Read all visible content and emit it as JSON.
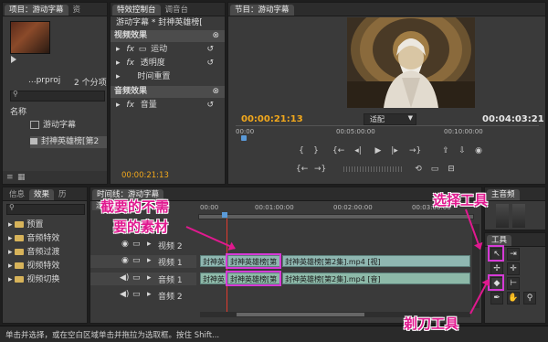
{
  "project": {
    "tab_project": "项目：游动字幕",
    "tab_resource": "资",
    "file_name": "...prproj",
    "item_count": "2 个分项",
    "search_placeholder": "",
    "col_name": "名称",
    "items": [
      {
        "label": "游动字幕"
      },
      {
        "label": "封神英雄榜[第2"
      }
    ]
  },
  "effect_controls": {
    "tab_label": "特效控制台",
    "tab_mixer": "调音台",
    "header_title": "游动字幕 * 封神英雄榜[",
    "video_section": "视频效果",
    "motion": "运动",
    "opacity": "透明度",
    "time_remap": "时间重置",
    "audio_section": "音频效果",
    "volume": "音量",
    "timecode": "00:00:21:13"
  },
  "program": {
    "tab_label": "节目：游动字幕",
    "timecode_current": "00:00:21:13",
    "fit_label": "适配",
    "timecode_duration": "00:04:03:21",
    "ruler": [
      "00:00",
      "00:05:00:00",
      "00:10:00:00"
    ]
  },
  "info_effects": {
    "tab_info": "信息",
    "tab_effects": "效果",
    "tab_history": "历",
    "folders": [
      "预置",
      "音频特效",
      "音频过渡",
      "视频特效",
      "视频切换"
    ]
  },
  "timeline": {
    "tab_label": "时间线：游动字幕",
    "sequence_name": "游动字幕",
    "ruler": [
      "00:00",
      "00:01:00:00",
      "00:02:00:00",
      "00:03:00:00"
    ],
    "tracks": [
      {
        "name": "视频 2",
        "type": "video"
      },
      {
        "name": "视频 1",
        "type": "video"
      },
      {
        "name": "音频 1",
        "type": "audio"
      },
      {
        "name": "音频 2",
        "type": "audio"
      }
    ],
    "clips": {
      "v1a": "封神英",
      "v1b": "封神英雄榜[第",
      "v1c": "封神英雄榜[第2集].mp4 [视]",
      "a1a": "封神英",
      "a1b": "封神英雄榜[第",
      "a1c": "封神英雄榜[第2集].mp4 [音]"
    }
  },
  "master": {
    "tab_label": "主音频"
  },
  "tools": {
    "tab_label": "工具"
  },
  "status_bar": "单击并选择，或在空白区域单击并拖拉为选取框。按住 Shift...",
  "annotations": {
    "unwanted_clip_line1": "截要的不需",
    "unwanted_clip_line2": "要的素材",
    "selection_tool": "选择工具",
    "razor_tool": "剃刀工具"
  },
  "colors": {
    "annotation": "#e0198f",
    "highlight_box": "#d63ad6",
    "timecode": "#f2a81c",
    "clip": "#8fb7b1",
    "playhead": "#e23b2e"
  }
}
